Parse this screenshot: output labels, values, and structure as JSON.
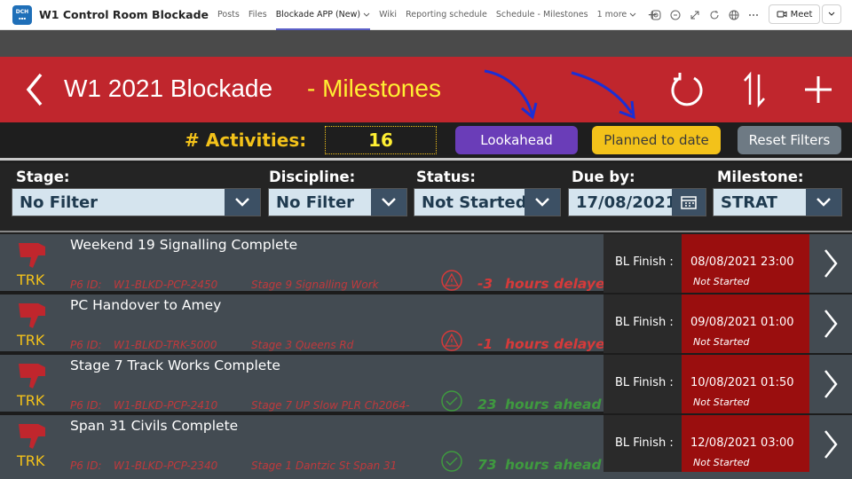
{
  "teams": {
    "app_icon_text": "DCH",
    "team_title": "W1 Control Room Blockade",
    "tabs": [
      {
        "label": "Posts",
        "active": false
      },
      {
        "label": "Files",
        "active": false
      },
      {
        "label": "Blockade APP (New)",
        "active": true
      },
      {
        "label": "Wiki",
        "active": false
      },
      {
        "label": "Reporting schedule",
        "active": false
      },
      {
        "label": "Schedule - Milestones",
        "active": false
      },
      {
        "label": "1 more",
        "active": false
      }
    ],
    "meet_label": "Meet"
  },
  "header": {
    "title": "W1 2021 Blockade",
    "subtitle": "- Milestones",
    "bg_color": "#c0262d",
    "icons": [
      "back-chevron-icon",
      "refresh-icon",
      "sort-icon",
      "add-icon"
    ]
  },
  "activities": {
    "label": "# Activities:",
    "count": "16",
    "lookahead_label": "Lookahead",
    "planned_label": "Planned to date",
    "reset_label": "Reset Filters"
  },
  "filters": {
    "stage": {
      "label": "Stage:",
      "value": "No Filter"
    },
    "discipline": {
      "label": "Discipline:",
      "value": "No Filter"
    },
    "status": {
      "label": "Status:",
      "value": "Not Started"
    },
    "due": {
      "label": "Due by:",
      "value": "17/08/2021"
    },
    "milestone": {
      "label": "Milestone:",
      "value": "STRAT"
    }
  },
  "rows": [
    {
      "discipline": "TRK",
      "title": "Weekend 19 Signalling Complete",
      "p6_label": "P6 ID:",
      "p6_id": "W1-BLKD-PCP-2450",
      "stage": "Stage 9 Signalling Work",
      "status_icon": "warning-icon",
      "delta": "-3",
      "delta_text": "hours delayed",
      "delta_color": "#d63a3a",
      "bl_label": "BL Finish :",
      "bl_finish": "08/08/2021 23:00",
      "bl_status": "Not Started"
    },
    {
      "discipline": "TRK",
      "title": "PC Handover to Amey",
      "p6_label": "P6 ID:",
      "p6_id": "W1-BLKD-TRK-5000",
      "stage": "Stage 3 Queens Rd",
      "status_icon": "warning-icon",
      "delta": "-1",
      "delta_text": "hours delayed",
      "delta_color": "#d63a3a",
      "bl_label": "BL Finish :",
      "bl_finish": "09/08/2021 01:00",
      "bl_status": "Not Started"
    },
    {
      "discipline": "TRK",
      "title": "Stage 7 Track Works Complete",
      "p6_label": "P6 ID:",
      "p6_id": "W1-BLKD-PCP-2410",
      "stage": "Stage 7 UP Slow PLR Ch2064-",
      "status_icon": "check-circle-icon",
      "delta": "23",
      "delta_text": "hours ahead",
      "delta_color": "#3f9a3f",
      "bl_label": "BL Finish :",
      "bl_finish": "10/08/2021 01:50",
      "bl_status": "Not Started"
    },
    {
      "discipline": "TRK",
      "title": "Span 31 Civils Complete",
      "p6_label": "P6 ID:",
      "p6_id": "W1-BLKD-PCP-2340",
      "stage": "Stage 1 Dantzic St Span 31",
      "status_icon": "check-circle-icon",
      "delta": "73",
      "delta_text": "hours ahead",
      "delta_color": "#3f9a3f",
      "bl_label": "BL Finish :",
      "bl_finish": "12/08/2021 03:00",
      "bl_status": "Not Started"
    }
  ]
}
